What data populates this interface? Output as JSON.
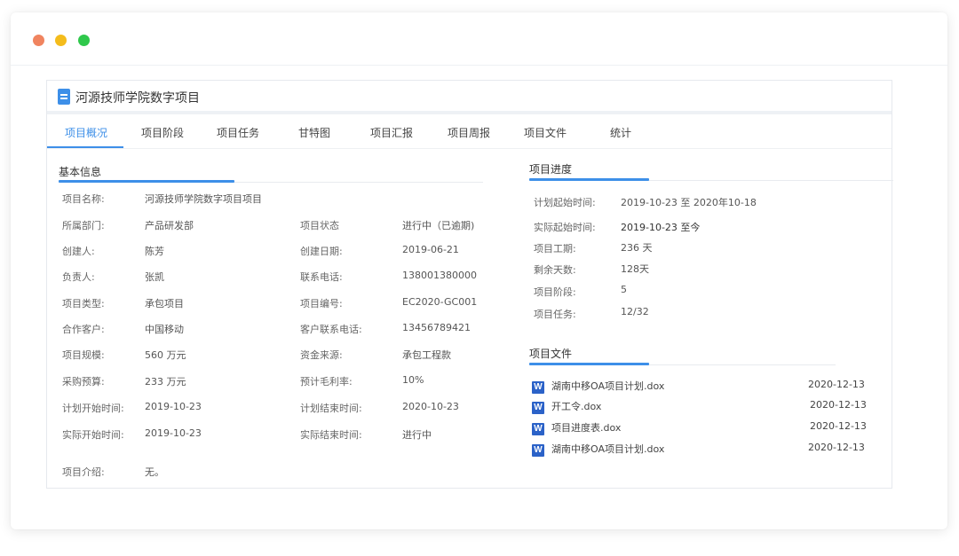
{
  "project_title": "河源技师学院数字项目",
  "tabs": [
    "项目概况",
    "项目阶段",
    "项目任务",
    "甘特图",
    "项目汇报",
    "项目周报",
    "项目文件",
    "统计"
  ],
  "basic_info": {
    "section_title": "基本信息",
    "project_name": {
      "label": "项目名称:",
      "value": "河源技师学院数字项目项目"
    },
    "left_rows": [
      {
        "label": "所属部门:",
        "value": "产品研发部"
      },
      {
        "label": "创建人:",
        "value": "陈芳"
      },
      {
        "label": "负责人:",
        "value": "张凯"
      },
      {
        "label": "项目类型:",
        "value": "承包项目"
      },
      {
        "label": "合作客户:",
        "value": "中国移动"
      },
      {
        "label": "项目规模:",
        "value": "560 万元"
      },
      {
        "label": "采购预算:",
        "value": "233 万元"
      },
      {
        "label": "计划开始时间:",
        "value": "2019-10-23"
      },
      {
        "label": "实际开始时间:",
        "value": "2019-10-23"
      }
    ],
    "right_rows": [
      {
        "label": "项目状态",
        "value": "进行中（已逾期)"
      },
      {
        "label": "创建日期:",
        "value": "2019-06-21"
      },
      {
        "label": "联系电话:",
        "value": "138001380000"
      },
      {
        "label": "项目编号:",
        "value": "EC2020-GC001"
      },
      {
        "label": "客户联系电话:",
        "value": "13456789421"
      },
      {
        "label": "资金来源:",
        "value": "承包工程款"
      },
      {
        "label": "预计毛利率:",
        "value": "10%"
      },
      {
        "label": "计划结束时间:",
        "value": "2020-10-23"
      },
      {
        "label": "实际结束时间:",
        "value": "进行中"
      }
    ],
    "intro": {
      "label": "项目介绍:",
      "value": "无。"
    }
  },
  "progress": {
    "section_title": "项目进度",
    "rows": [
      {
        "label": "计划起始时间:",
        "value": "2019-10-23 至 2020年10-18"
      },
      {
        "label": "实际起始时间:",
        "value": "2019-10-23 至今"
      },
      {
        "label": "项目工期:",
        "value": "236 天"
      },
      {
        "label": "剩余天数:",
        "value": "128天"
      },
      {
        "label": "项目阶段:",
        "value": "5"
      },
      {
        "label": "项目任务:",
        "value": "12/32"
      }
    ]
  },
  "files": {
    "section_title": "项目文件",
    "icon": "word-doc-icon",
    "items": [
      {
        "name": "湖南中移OA项目计划.dox",
        "date": "2020-12-13"
      },
      {
        "name": "开工令.dox",
        "date": "2020-12-13"
      },
      {
        "name": "项目进度表.dox",
        "date": "2020-12-13"
      },
      {
        "name": "湖南中移OA项目计划.dox",
        "date": "2020-12-13"
      }
    ]
  },
  "colors": {
    "accent": "#3d8fe8",
    "word_icon": "#2b62c8",
    "dot_red": "#f0845f",
    "dot_yellow": "#f4bc1c",
    "dot_green": "#2fc84b"
  }
}
